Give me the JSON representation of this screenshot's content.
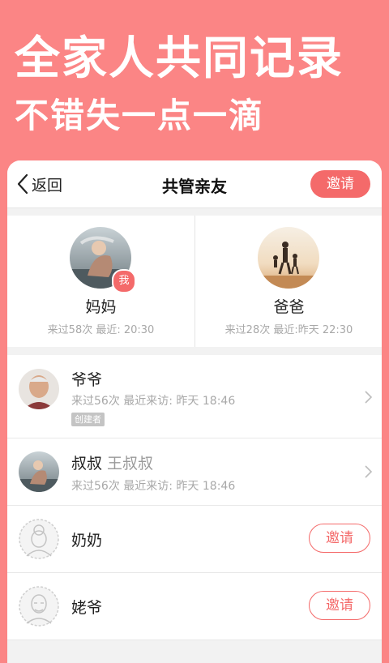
{
  "promo": {
    "headline": "全家人共同记录",
    "subheadline": "不错失一点一滴"
  },
  "navbar": {
    "back_label": "返回",
    "title": "共管亲友",
    "invite_label": "邀请"
  },
  "top_members": [
    {
      "name": "妈妈",
      "badge": "我",
      "meta": "来过58次  最近: 20:30"
    },
    {
      "name": "爸爸",
      "meta": "来过28次  最近:昨天 22:30"
    }
  ],
  "members": [
    {
      "name": "爷爷",
      "meta": "来过56次  最近来访:  昨天 18:46",
      "tag": "创建者"
    },
    {
      "name": "叔叔",
      "alias": "王叔叔",
      "meta": "来过56次  最近来访:  昨天 18:46"
    },
    {
      "name": "奶奶",
      "invite_label": "邀请"
    },
    {
      "name": "姥爷",
      "invite_label": "邀请"
    }
  ],
  "colors": {
    "brand": "#fb8585",
    "accent": "#f46a6a"
  }
}
